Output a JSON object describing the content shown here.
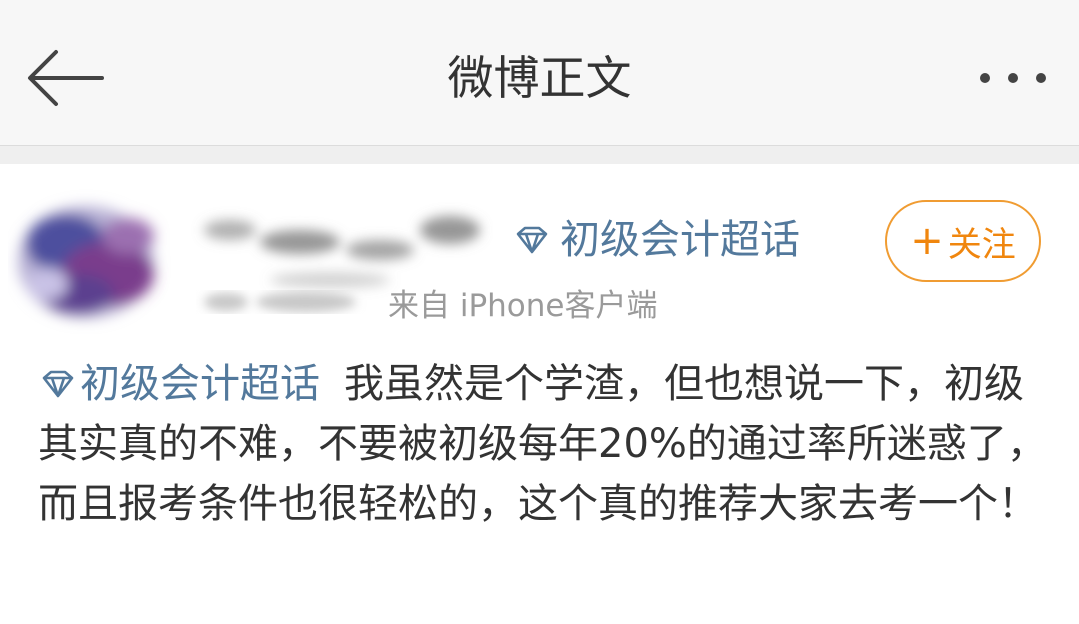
{
  "nav": {
    "title": "微博正文"
  },
  "post": {
    "super_topic": "初级会计超话",
    "source": "来自 iPhone客户端",
    "follow_label": "关注",
    "follow_plus": "+",
    "body_topic": "初级会计超话",
    "body_text": "我虽然是个学渣，但也想说一下，初级其实真的不难，不要被初级每年20%的通过率所迷惑了，而且报考条件也很轻松的，这个真的推荐大家去考一个！"
  },
  "colors": {
    "link": "#53799c",
    "follow": "#f09c32",
    "text": "#333333",
    "meta": "#9a9a9a"
  },
  "icons": [
    "back-arrow-icon",
    "more-icon",
    "diamond-icon",
    "plus-icon"
  ]
}
